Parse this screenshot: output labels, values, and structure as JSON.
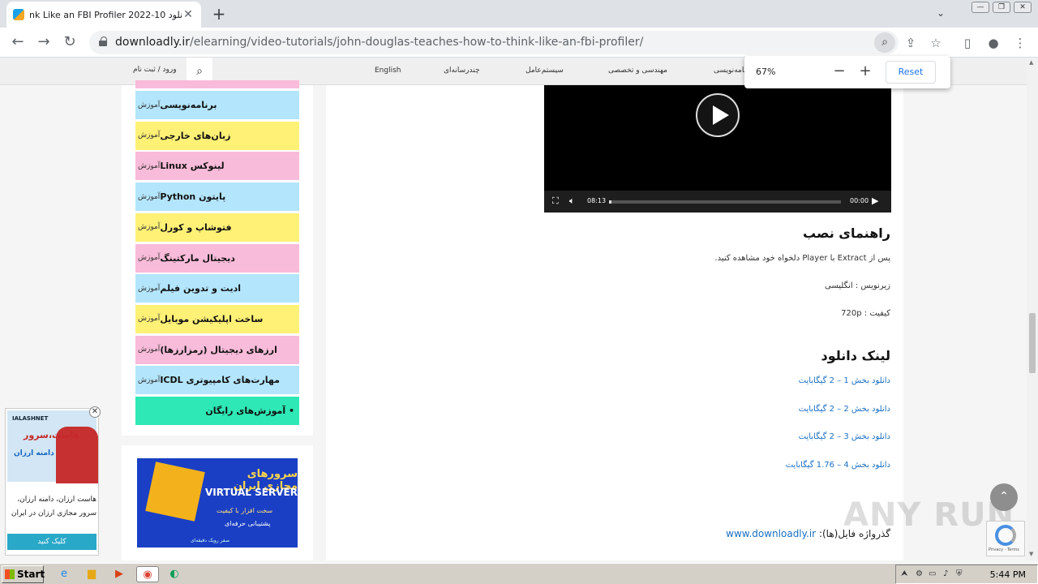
{
  "browser": {
    "tab_title": "nk Like an FBI Profiler 2022-10 دانلود",
    "url_host": "downloadly.ir",
    "url_path": "/elearning/video-tutorials/john-douglas-teaches-how-to-think-like-an-fbi-profiler/"
  },
  "zoom": {
    "value": "67%",
    "minus": "−",
    "plus": "+",
    "reset": "Reset"
  },
  "site": {
    "login": "ورود / ثبت نام",
    "menu": [
      "English",
      "چندرسانه‌ای",
      "سیستم‌عامل",
      "مهندسی و تخصصی",
      "برنامه‌نویسی"
    ]
  },
  "sidebar": {
    "prefix": "آموزش",
    "categories": [
      {
        "name": "برنامه‌نویسی",
        "color": "#b3e5fc"
      },
      {
        "name": "زبان‌های خارجی",
        "color": "#fff176"
      },
      {
        "name": "لینوکس Linux",
        "color": "#f8bbd9"
      },
      {
        "name": "پایتون Python",
        "color": "#b3e5fc"
      },
      {
        "name": "فتوشاپ و کورل",
        "color": "#fff176"
      },
      {
        "name": "دیجیتال مارکتینگ",
        "color": "#f8bbd9"
      },
      {
        "name": "ادیت و تدوین فیلم",
        "color": "#b3e5fc"
      },
      {
        "name": "ساخت اپلیکیشن موبایل",
        "color": "#fff176"
      },
      {
        "name": "ارزهای دیجیتال (رمزارزها)",
        "color": "#f8bbd9"
      },
      {
        "name": "مهارت‌های کامپیوتری ICDL",
        "color": "#b3e5fc"
      }
    ],
    "free": "• آموزش‌های رایگان"
  },
  "banner": {
    "title": "سرورهای مجازی ایران",
    "sub": "VIRTUAL SERVER",
    "line1": "سخت افزار با کیفیت",
    "line2": "پشتیبانی حرفه‌ای",
    "line3": "صفر رویک دقیقه‌ای"
  },
  "video": {
    "time": "08:13",
    "remaining": "00:00",
    "progress": 0.01
  },
  "content": {
    "install_heading": "راهنمای نصب",
    "install_text": "پس از Extract با Player دلخواه خود مشاهده کنید.",
    "subtitle": "زیرنویس : انگلیسی",
    "quality": "کیفیت : 720p",
    "download_heading": "لینک دانلود",
    "downloads": [
      "دانلود بخش 1 – 2 گیگابایت",
      "دانلود بخش 2 – 2 گیگابایت",
      "دانلود بخش 3 – 2 گیگابایت",
      "دانلود بخش 4 – 1.76 گیگابایت"
    ],
    "password_label": "گذرواژه فایل(ها):",
    "password_value": "www.downloadly.ir"
  },
  "ad": {
    "brand": "IALASHNET",
    "headline": "هاست،سرور",
    "sub": "دامنه ارزان",
    "text": "هاست ارزان، دامنه ارزان، سرور مجازی ارزان در ایران",
    "cta": "کلیک کنید"
  },
  "recaptcha": "Privacy - Terms",
  "watermark": "ANY RUN",
  "taskbar": {
    "start": "Start",
    "clock": "5:44 PM"
  }
}
